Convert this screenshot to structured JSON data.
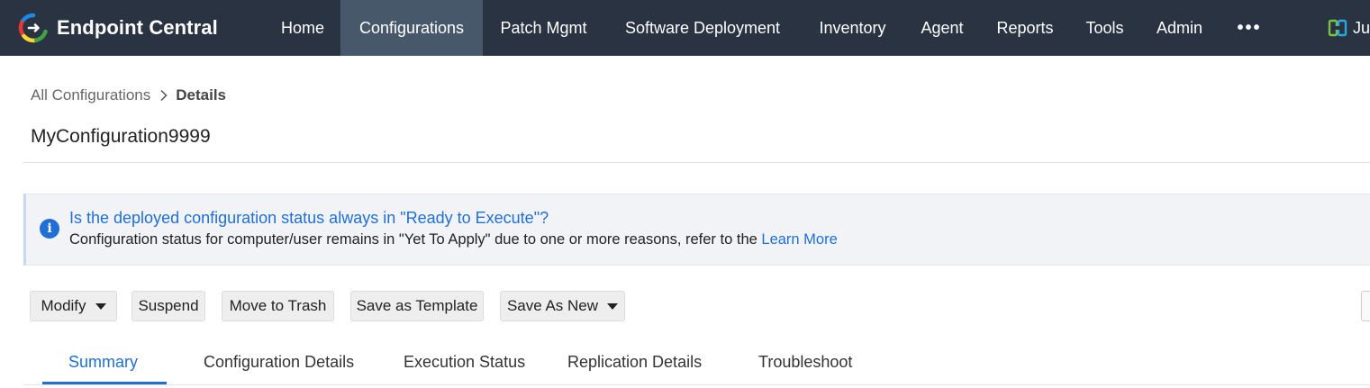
{
  "app": {
    "name": "Endpoint Central",
    "logo_icon": "endpoint-central-logo-icon"
  },
  "nav": {
    "items": [
      {
        "label": "Home",
        "active": false
      },
      {
        "label": "Configurations",
        "active": true
      },
      {
        "label": "Patch Mgmt",
        "active": false
      },
      {
        "label": "Software Deployment",
        "active": false
      },
      {
        "label": "Inventory",
        "active": false
      },
      {
        "label": "Agent",
        "active": false
      },
      {
        "label": "Reports",
        "active": false
      },
      {
        "label": "Tools",
        "active": false
      },
      {
        "label": "Admin",
        "active": false
      }
    ],
    "more_label": "•••",
    "user_partial": "Ju",
    "user_icon": "workspace-switch-icon"
  },
  "breadcrumb": {
    "parent": "All Configurations",
    "current": "Details"
  },
  "page": {
    "title": "MyConfiguration9999"
  },
  "banner": {
    "question": "Is the deployed configuration status always in \"Ready to Execute\"?",
    "text": "Configuration status for computer/user remains in \"Yet To Apply\" due to one or more reasons, refer to the ",
    "link": "Learn More"
  },
  "toolbar": {
    "modify_label": "Modify",
    "suspend_label": "Suspend",
    "trash_label": "Move to Trash",
    "template_label": "Save as Template",
    "save_new_label": "Save As New"
  },
  "tabs": [
    {
      "label": "Summary",
      "active": true
    },
    {
      "label": "Configuration Details",
      "active": false
    },
    {
      "label": "Execution Status",
      "active": false
    },
    {
      "label": "Replication Details",
      "active": false
    },
    {
      "label": "Troubleshoot",
      "active": false
    }
  ],
  "colors": {
    "nav_bg": "#2a3342",
    "nav_active_bg": "#48586b",
    "accent": "#1f6fd6",
    "banner_bg": "#f1f3f7"
  }
}
